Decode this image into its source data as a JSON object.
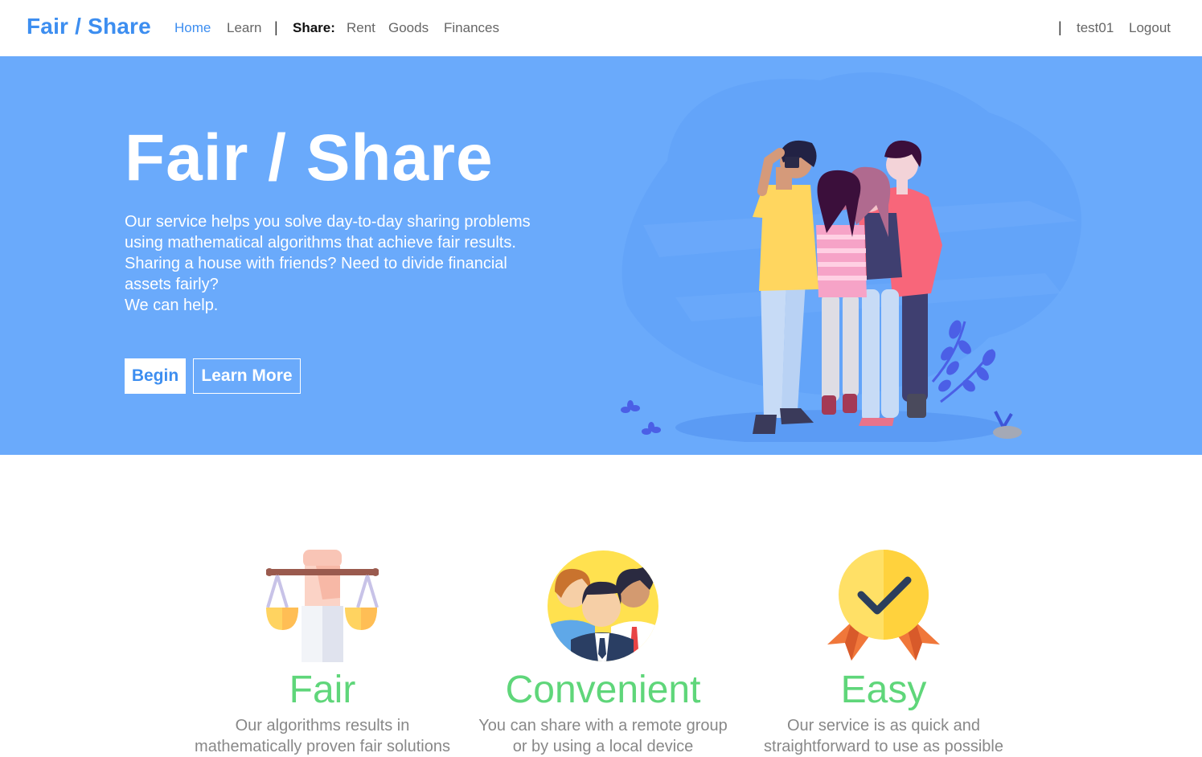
{
  "nav": {
    "brand": "Fair / Share",
    "home": "Home",
    "learn": "Learn",
    "sep1": "|",
    "share_label": "Share:",
    "rent": "Rent",
    "goods": "Goods",
    "finances": "Finances",
    "sep2": "|",
    "username": "test01",
    "logout": "Logout"
  },
  "hero": {
    "title": "Fair / Share",
    "paragraph_lines": [
      "Our service helps you solve day-to-day sharing problems",
      "using mathematical algorithms that achieve fair results.",
      "Sharing a house with friends? Need to divide financial",
      "assets fairly?",
      "We can help."
    ],
    "begin_button": "Begin",
    "learn_more_button": "Learn More",
    "illustration": "group-selfie-illustration"
  },
  "features": [
    {
      "icon": "scales-icon",
      "title": "Fair",
      "desc_lines": [
        "Our algorithms results in",
        "mathematically proven fair solutions"
      ]
    },
    {
      "icon": "group-icon",
      "title": "Convenient",
      "desc_lines": [
        "You can share with a remote group",
        "or by using a local device"
      ]
    },
    {
      "icon": "medal-icon",
      "title": "Easy",
      "desc_lines": [
        "Our service is as quick and",
        "straightforward to use as possible"
      ]
    }
  ],
  "colors": {
    "brand": "#3d8ef0",
    "hero_bg": "#6aaafb",
    "feature_title": "#5fd67a"
  }
}
